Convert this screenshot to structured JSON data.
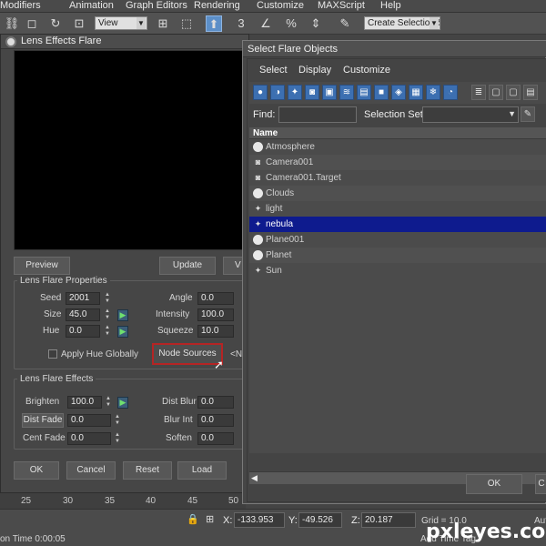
{
  "app_menu": [
    "Modifiers",
    "Animation",
    "Graph Editors",
    "Rendering",
    "Customize",
    "MAXScript",
    "Help"
  ],
  "toolbar": {
    "view_combo": "View",
    "selection_set_combo": "Create Selection Se"
  },
  "lens_effects": {
    "title": "Lens Effects Flare",
    "buttons": {
      "preview": "Preview",
      "update": "Update",
      "vp": "V"
    },
    "properties": {
      "title": "Lens Flare Properties",
      "seed_label": "Seed",
      "seed": "2001",
      "size_label": "Size",
      "size": "45.0",
      "hue_label": "Hue",
      "hue": "0.0",
      "angle_label": "Angle",
      "angle": "0.0",
      "intensity_label": "Intensity",
      "intensity": "100.0",
      "squeeze_label": "Squeeze",
      "squeeze": "10.0",
      "apply_hue_label": "Apply Hue Globally",
      "node_sources_label": "Node Sources",
      "node_sources_value": "<N"
    },
    "effects": {
      "title": "Lens Flare Effects",
      "brighten_label": "Brighten",
      "brighten": "100.0",
      "dist_fade_label": "Dist Fade",
      "dist_fade": "0.0",
      "cent_fade_label": "Cent Fade",
      "cent_fade": "0.0",
      "dist_blur_label": "Dist Blur",
      "dist_blur": "0.0",
      "blur_int_label": "Blur Int",
      "blur_int": "0.0",
      "soften_label": "Soften",
      "soften": "0.0"
    },
    "footer": {
      "ok": "OK",
      "cancel": "Cancel",
      "reset": "Reset",
      "load": "Load"
    }
  },
  "select_flare": {
    "title": "Select Flare Objects",
    "menu": [
      "Select",
      "Display",
      "Customize"
    ],
    "find_label": "Find:",
    "find_value": "",
    "selection_set_label": "Selection Set:",
    "column_header": "Name",
    "objects": [
      {
        "name": "Atmosphere",
        "icon": "sphere-icon",
        "selected": false
      },
      {
        "name": "Camera001",
        "icon": "camera-icon",
        "selected": false
      },
      {
        "name": "Camera001.Target",
        "icon": "camera-icon",
        "selected": false
      },
      {
        "name": "Clouds",
        "icon": "sphere-icon",
        "selected": false
      },
      {
        "name": "light",
        "icon": "light-icon",
        "selected": false
      },
      {
        "name": "nebula",
        "icon": "light-icon",
        "selected": true
      },
      {
        "name": "Plane001",
        "icon": "sphere-icon",
        "selected": false
      },
      {
        "name": "Planet",
        "icon": "sphere-icon",
        "selected": false
      },
      {
        "name": "Sun",
        "icon": "light-icon",
        "selected": false
      }
    ],
    "ok": "OK",
    "cancel_partial": "C"
  },
  "timeline": {
    "ticks": [
      "25",
      "30",
      "35",
      "40",
      "45",
      "50",
      "55",
      "60",
      "65"
    ]
  },
  "status": {
    "time_label": "on Time  0:00:05",
    "x_label": "X:",
    "x": "-133.953",
    "y_label": "Y:",
    "y": "-49.526",
    "z_label": "Z:",
    "z": "20.187",
    "grid": "Grid = 10.0",
    "add_time_tag": "Add Time Tag",
    "auto_partial": "Auto"
  },
  "watermark": "pxleyes.com"
}
